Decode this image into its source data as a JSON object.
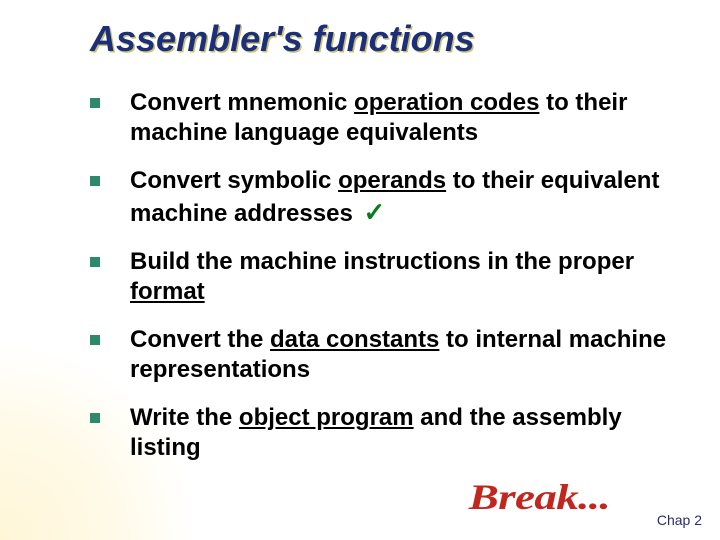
{
  "title": "Assembler's functions",
  "bullets": [
    {
      "segments": [
        {
          "t": "Convert mnemonic "
        },
        {
          "t": "operation codes",
          "u": true
        },
        {
          "t": " to their machine language equivalents"
        }
      ],
      "check": false
    },
    {
      "segments": [
        {
          "t": "Convert symbolic "
        },
        {
          "t": "operands",
          "u": true
        },
        {
          "t": " to their equivalent machine addresses "
        }
      ],
      "check": true
    },
    {
      "segments": [
        {
          "t": "Build the machine instructions in the proper "
        },
        {
          "t": "format",
          "u": true
        }
      ],
      "check": false
    },
    {
      "segments": [
        {
          "t": "Convert the "
        },
        {
          "t": "data constants",
          "u": true
        },
        {
          "t": " to internal machine representations"
        }
      ],
      "check": false
    },
    {
      "segments": [
        {
          "t": "Write the "
        },
        {
          "t": "object program",
          "u": true
        },
        {
          "t": " and the assembly listing"
        }
      ],
      "check": false
    }
  ],
  "break_text": "Break...",
  "check_glyph": "✓",
  "footer": "Chap 2"
}
